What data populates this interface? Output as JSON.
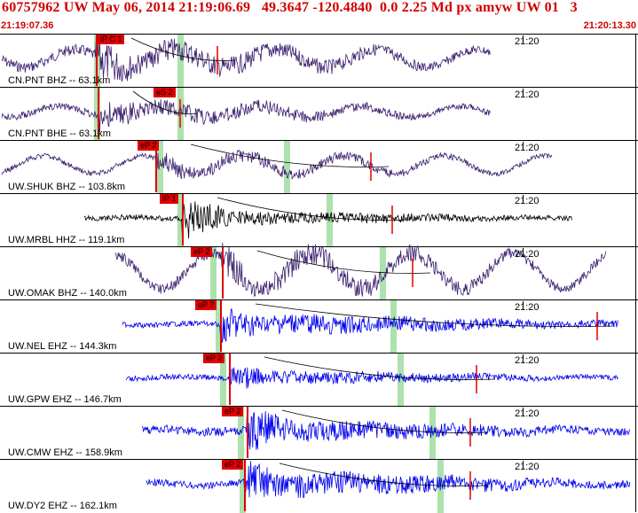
{
  "header": {
    "title": "60757962 UW May 06, 2014 21:19:06.69   49.3647 -120.4840  0.0 2.25 Md px amyw UW 01   3",
    "time_start": "21:19:07.36",
    "time_end": "21:20:13.30"
  },
  "colors": {
    "header_text": "#d00000",
    "pick_box": "#e00000",
    "trace_purple": "#3b1f6e",
    "trace_black": "#000000",
    "trace_blue": "#0000ee",
    "window_band": "#9fdc9f"
  },
  "time_marker_label": "21:20",
  "traces": [
    {
      "station": "CN.PNT BHZ -- 63.1km",
      "pick": "iP C 1",
      "color": "purple",
      "icon": "seismogram-trace"
    },
    {
      "station": "CN.PNT BHE -- 63.1km",
      "pick": "eS 2",
      "color": "purple",
      "icon": "seismogram-trace"
    },
    {
      "station": "UW.SHUK BHZ -- 103.8km",
      "pick": "eP 2",
      "color": "purple",
      "icon": "seismogram-trace"
    },
    {
      "station": "UW.MRBL HHZ -- 119.1km",
      "pick": "iP 1",
      "color": "black",
      "icon": "seismogram-trace"
    },
    {
      "station": "UW.OMAK BHZ -- 140.0km",
      "pick": "eP 2",
      "color": "purple",
      "icon": "seismogram-trace"
    },
    {
      "station": "UW.NEL EHZ -- 144.3km",
      "pick": "eP 2",
      "color": "blue",
      "icon": "seismogram-trace"
    },
    {
      "station": "UW.GPW EHZ -- 146.7km",
      "pick": "eP 2",
      "color": "blue",
      "icon": "seismogram-trace"
    },
    {
      "station": "UW.CMW EHZ -- 158.9km",
      "pick": "eP 2",
      "color": "blue",
      "icon": "seismogram-trace"
    },
    {
      "station": "UW.DY2 EHZ -- 162.1km",
      "pick": "eP 2",
      "color": "blue",
      "icon": "seismogram-trace"
    }
  ]
}
